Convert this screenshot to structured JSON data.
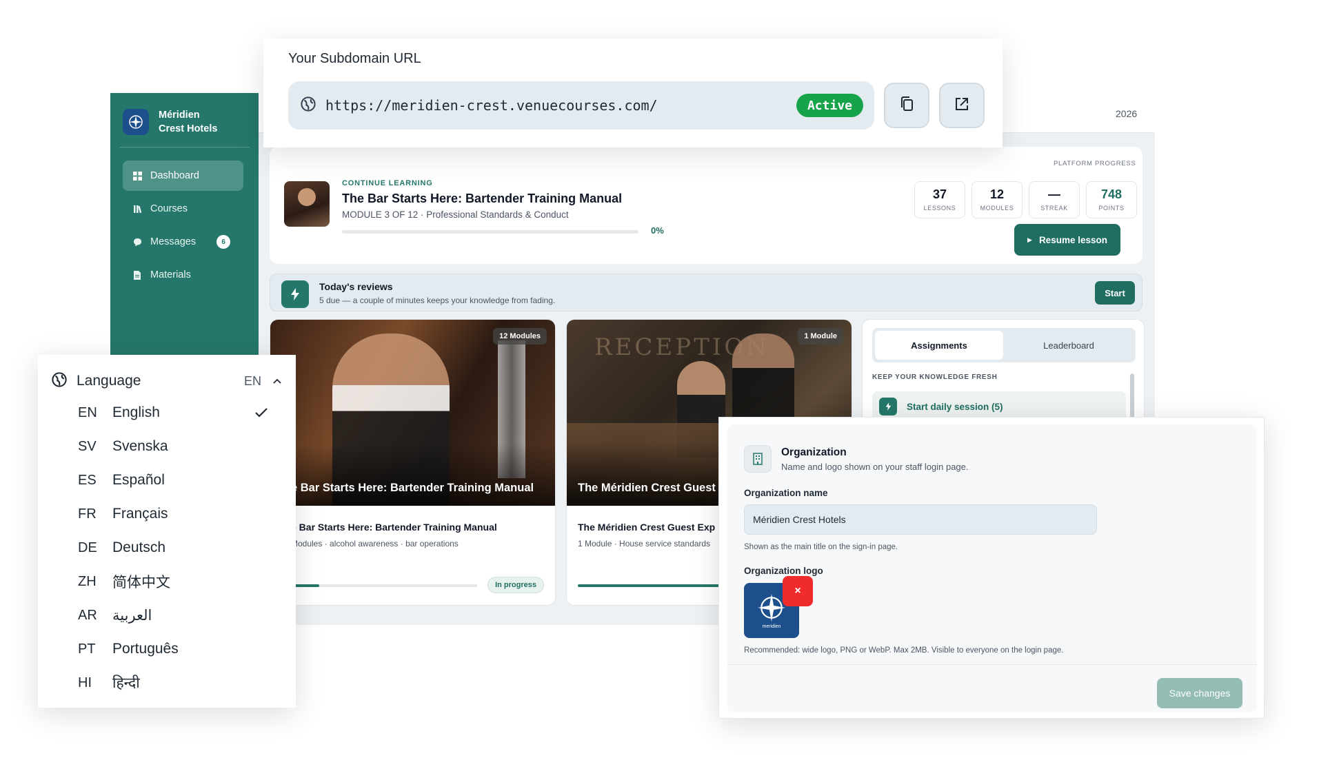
{
  "sidebar": {
    "brand": {
      "line1": "Méridien",
      "line2": "Crest Hotels"
    },
    "items": [
      {
        "label": "Dashboard"
      },
      {
        "label": "Courses"
      },
      {
        "label": "Messages",
        "badge": "6"
      },
      {
        "label": "Materials"
      }
    ]
  },
  "topbar": {
    "year": "2026"
  },
  "continue": {
    "eyebrow": "CONTINUE LEARNING",
    "title": "The Bar Starts Here: Bartender Training Manual",
    "subtitle": "MODULE 3 OF 12 · Professional Standards & Conduct",
    "progress_label": "0%",
    "progress": 0
  },
  "platform": {
    "label": "PLATFORM PROGRESS",
    "stats": [
      {
        "value": "37",
        "label": "LESSONS"
      },
      {
        "value": "12",
        "label": "MODULES"
      },
      {
        "value": "—",
        "label": "STREAK"
      },
      {
        "value": "748",
        "label": "POINTS"
      }
    ],
    "resume_label": "Resume lesson"
  },
  "reviews": {
    "title": "Today's reviews",
    "subtitle": "5 due — a couple of minutes keeps your knowledge from fading.",
    "start_label": "Start"
  },
  "courses": [
    {
      "chip": "12 Modules",
      "image_title": "e Bar Starts Here: Bartender Training Manual",
      "title": "e Bar Starts Here: Bartender Training Manual",
      "subtitle": "Modules · alcohol awareness · bar operations",
      "status": "In progress",
      "progress": 0.15
    },
    {
      "chip": "1 Module",
      "image_title": "The Méridien Crest Guest",
      "title": "The Méridien Crest Guest Exp",
      "subtitle": "1 Module · House service standards",
      "progress": 1
    }
  ],
  "assign": {
    "tabs": [
      "Assignments",
      "Leaderboard"
    ],
    "section": "KEEP YOUR KNOWLEDGE FRESH",
    "daily_label": "Start daily session (5)"
  },
  "subdomain": {
    "title": "Your Subdomain URL",
    "url": "https://meridien-crest.venuecourses.com/",
    "status": "Active"
  },
  "language": {
    "title": "Language",
    "current": "EN",
    "options": [
      {
        "code": "EN",
        "name": "English",
        "selected": true
      },
      {
        "code": "SV",
        "name": "Svenska"
      },
      {
        "code": "ES",
        "name": "Español"
      },
      {
        "code": "FR",
        "name": "Français"
      },
      {
        "code": "DE",
        "name": "Deutsch"
      },
      {
        "code": "ZH",
        "name": "简体中文"
      },
      {
        "code": "AR",
        "name": "العربية"
      },
      {
        "code": "PT",
        "name": "Português"
      },
      {
        "code": "HI",
        "name": "हिन्दी"
      }
    ]
  },
  "org": {
    "title": "Organization",
    "subtitle": "Name and logo shown on your staff login page.",
    "name_label": "Organization name",
    "name_value": "Méridien Crest Hotels",
    "name_hint": "Shown as the main title on the sign-in page.",
    "logo_label": "Organization logo",
    "logo_text": "meridien",
    "logo_hint": "Recommended: wide logo, PNG or WebP. Max 2MB. Visible to everyone on the login page.",
    "remove_label": "×",
    "save_label": "Save changes"
  },
  "colors": {
    "brand": "#24776a",
    "brand_dark": "#1f6e61",
    "active_green": "#16a34a",
    "danger": "#ef2b2b",
    "logo_blue": "#1d4f8c"
  }
}
